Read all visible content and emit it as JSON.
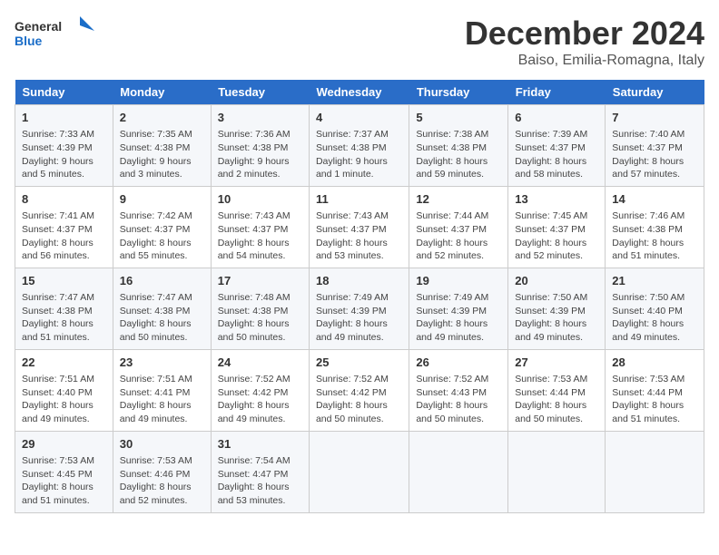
{
  "logo": {
    "line1": "General",
    "line2": "Blue"
  },
  "title": "December 2024",
  "subtitle": "Baiso, Emilia-Romagna, Italy",
  "days_of_week": [
    "Sunday",
    "Monday",
    "Tuesday",
    "Wednesday",
    "Thursday",
    "Friday",
    "Saturday"
  ],
  "weeks": [
    [
      {
        "day": "1",
        "sunrise": "Sunrise: 7:33 AM",
        "sunset": "Sunset: 4:39 PM",
        "daylight": "Daylight: 9 hours and 5 minutes."
      },
      {
        "day": "2",
        "sunrise": "Sunrise: 7:35 AM",
        "sunset": "Sunset: 4:38 PM",
        "daylight": "Daylight: 9 hours and 3 minutes."
      },
      {
        "day": "3",
        "sunrise": "Sunrise: 7:36 AM",
        "sunset": "Sunset: 4:38 PM",
        "daylight": "Daylight: 9 hours and 2 minutes."
      },
      {
        "day": "4",
        "sunrise": "Sunrise: 7:37 AM",
        "sunset": "Sunset: 4:38 PM",
        "daylight": "Daylight: 9 hours and 1 minute."
      },
      {
        "day": "5",
        "sunrise": "Sunrise: 7:38 AM",
        "sunset": "Sunset: 4:38 PM",
        "daylight": "Daylight: 8 hours and 59 minutes."
      },
      {
        "day": "6",
        "sunrise": "Sunrise: 7:39 AM",
        "sunset": "Sunset: 4:37 PM",
        "daylight": "Daylight: 8 hours and 58 minutes."
      },
      {
        "day": "7",
        "sunrise": "Sunrise: 7:40 AM",
        "sunset": "Sunset: 4:37 PM",
        "daylight": "Daylight: 8 hours and 57 minutes."
      }
    ],
    [
      {
        "day": "8",
        "sunrise": "Sunrise: 7:41 AM",
        "sunset": "Sunset: 4:37 PM",
        "daylight": "Daylight: 8 hours and 56 minutes."
      },
      {
        "day": "9",
        "sunrise": "Sunrise: 7:42 AM",
        "sunset": "Sunset: 4:37 PM",
        "daylight": "Daylight: 8 hours and 55 minutes."
      },
      {
        "day": "10",
        "sunrise": "Sunrise: 7:43 AM",
        "sunset": "Sunset: 4:37 PM",
        "daylight": "Daylight: 8 hours and 54 minutes."
      },
      {
        "day": "11",
        "sunrise": "Sunrise: 7:43 AM",
        "sunset": "Sunset: 4:37 PM",
        "daylight": "Daylight: 8 hours and 53 minutes."
      },
      {
        "day": "12",
        "sunrise": "Sunrise: 7:44 AM",
        "sunset": "Sunset: 4:37 PM",
        "daylight": "Daylight: 8 hours and 52 minutes."
      },
      {
        "day": "13",
        "sunrise": "Sunrise: 7:45 AM",
        "sunset": "Sunset: 4:37 PM",
        "daylight": "Daylight: 8 hours and 52 minutes."
      },
      {
        "day": "14",
        "sunrise": "Sunrise: 7:46 AM",
        "sunset": "Sunset: 4:38 PM",
        "daylight": "Daylight: 8 hours and 51 minutes."
      }
    ],
    [
      {
        "day": "15",
        "sunrise": "Sunrise: 7:47 AM",
        "sunset": "Sunset: 4:38 PM",
        "daylight": "Daylight: 8 hours and 51 minutes."
      },
      {
        "day": "16",
        "sunrise": "Sunrise: 7:47 AM",
        "sunset": "Sunset: 4:38 PM",
        "daylight": "Daylight: 8 hours and 50 minutes."
      },
      {
        "day": "17",
        "sunrise": "Sunrise: 7:48 AM",
        "sunset": "Sunset: 4:38 PM",
        "daylight": "Daylight: 8 hours and 50 minutes."
      },
      {
        "day": "18",
        "sunrise": "Sunrise: 7:49 AM",
        "sunset": "Sunset: 4:39 PM",
        "daylight": "Daylight: 8 hours and 49 minutes."
      },
      {
        "day": "19",
        "sunrise": "Sunrise: 7:49 AM",
        "sunset": "Sunset: 4:39 PM",
        "daylight": "Daylight: 8 hours and 49 minutes."
      },
      {
        "day": "20",
        "sunrise": "Sunrise: 7:50 AM",
        "sunset": "Sunset: 4:39 PM",
        "daylight": "Daylight: 8 hours and 49 minutes."
      },
      {
        "day": "21",
        "sunrise": "Sunrise: 7:50 AM",
        "sunset": "Sunset: 4:40 PM",
        "daylight": "Daylight: 8 hours and 49 minutes."
      }
    ],
    [
      {
        "day": "22",
        "sunrise": "Sunrise: 7:51 AM",
        "sunset": "Sunset: 4:40 PM",
        "daylight": "Daylight: 8 hours and 49 minutes."
      },
      {
        "day": "23",
        "sunrise": "Sunrise: 7:51 AM",
        "sunset": "Sunset: 4:41 PM",
        "daylight": "Daylight: 8 hours and 49 minutes."
      },
      {
        "day": "24",
        "sunrise": "Sunrise: 7:52 AM",
        "sunset": "Sunset: 4:42 PM",
        "daylight": "Daylight: 8 hours and 49 minutes."
      },
      {
        "day": "25",
        "sunrise": "Sunrise: 7:52 AM",
        "sunset": "Sunset: 4:42 PM",
        "daylight": "Daylight: 8 hours and 50 minutes."
      },
      {
        "day": "26",
        "sunrise": "Sunrise: 7:52 AM",
        "sunset": "Sunset: 4:43 PM",
        "daylight": "Daylight: 8 hours and 50 minutes."
      },
      {
        "day": "27",
        "sunrise": "Sunrise: 7:53 AM",
        "sunset": "Sunset: 4:44 PM",
        "daylight": "Daylight: 8 hours and 50 minutes."
      },
      {
        "day": "28",
        "sunrise": "Sunrise: 7:53 AM",
        "sunset": "Sunset: 4:44 PM",
        "daylight": "Daylight: 8 hours and 51 minutes."
      }
    ],
    [
      {
        "day": "29",
        "sunrise": "Sunrise: 7:53 AM",
        "sunset": "Sunset: 4:45 PM",
        "daylight": "Daylight: 8 hours and 51 minutes."
      },
      {
        "day": "30",
        "sunrise": "Sunrise: 7:53 AM",
        "sunset": "Sunset: 4:46 PM",
        "daylight": "Daylight: 8 hours and 52 minutes."
      },
      {
        "day": "31",
        "sunrise": "Sunrise: 7:54 AM",
        "sunset": "Sunset: 4:47 PM",
        "daylight": "Daylight: 8 hours and 53 minutes."
      },
      null,
      null,
      null,
      null
    ]
  ]
}
